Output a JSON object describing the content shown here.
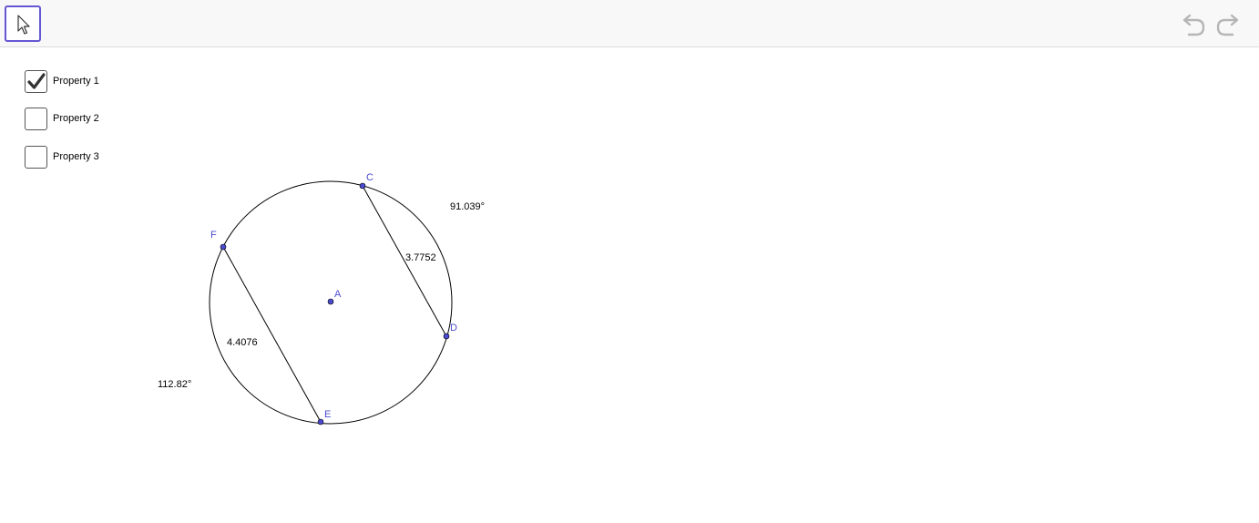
{
  "toolbar": {
    "move_tool_icon": "arrow-cursor-icon",
    "undo_icon": "undo-icon",
    "redo_icon": "redo-icon",
    "accent_color": "#6557d2"
  },
  "checkboxes": [
    {
      "label": "Property 1",
      "checked": true
    },
    {
      "label": "Property 2",
      "checked": false
    },
    {
      "label": "Property 3",
      "checked": false
    }
  ],
  "construction": {
    "point_color": "#4a4ad0",
    "points": {
      "A": "A",
      "C": "C",
      "D": "D",
      "E": "E",
      "F": "F"
    },
    "values": {
      "chord_cd_length": "3.7752",
      "chord_fe_length": "4.4076",
      "arc_cd_angle": "91.039°",
      "arc_fe_angle": "112.82°"
    }
  }
}
